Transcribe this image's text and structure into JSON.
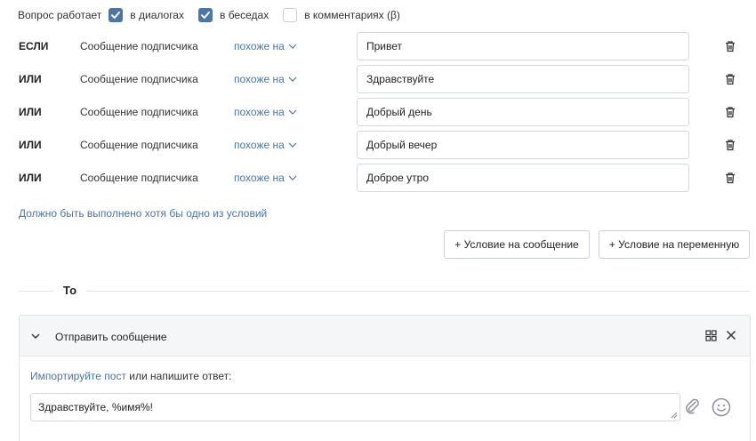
{
  "works_in": {
    "label": "Вопрос работает",
    "options": [
      {
        "label": "в диалогах",
        "checked": true
      },
      {
        "label": "в беседах",
        "checked": true
      },
      {
        "label": "в комментариях (β)",
        "checked": false
      }
    ]
  },
  "conditions": [
    {
      "operator": "ЕСЛИ",
      "source": "Сообщение подписчика",
      "match": "похоже на",
      "value": "Привет"
    },
    {
      "operator": "ИЛИ",
      "source": "Сообщение подписчика",
      "match": "похоже на",
      "value": "Здравствуйте"
    },
    {
      "operator": "ИЛИ",
      "source": "Сообщение подписчика",
      "match": "похоже на",
      "value": "Добрый день"
    },
    {
      "operator": "ИЛИ",
      "source": "Сообщение подписчика",
      "match": "похоже на",
      "value": "Добрый вечер"
    },
    {
      "operator": "ИЛИ",
      "source": "Сообщение подписчика",
      "match": "похоже на",
      "value": "Доброе утро"
    }
  ],
  "hint": "Должно быть выполнено хотя бы одно из условий",
  "buttons": {
    "add_message_condition": "+ Условие на сообщение",
    "add_variable_condition": "+ Условие на переменную"
  },
  "then_label": "То",
  "action": {
    "title": "Отправить сообщение",
    "import_link": "Импортируйте пост",
    "import_rest": " или напишите ответ:",
    "reply_text": "Здравствуйте, %имя%!"
  },
  "colors": {
    "accent": "#4a76a8",
    "border": "#d3d9de"
  }
}
